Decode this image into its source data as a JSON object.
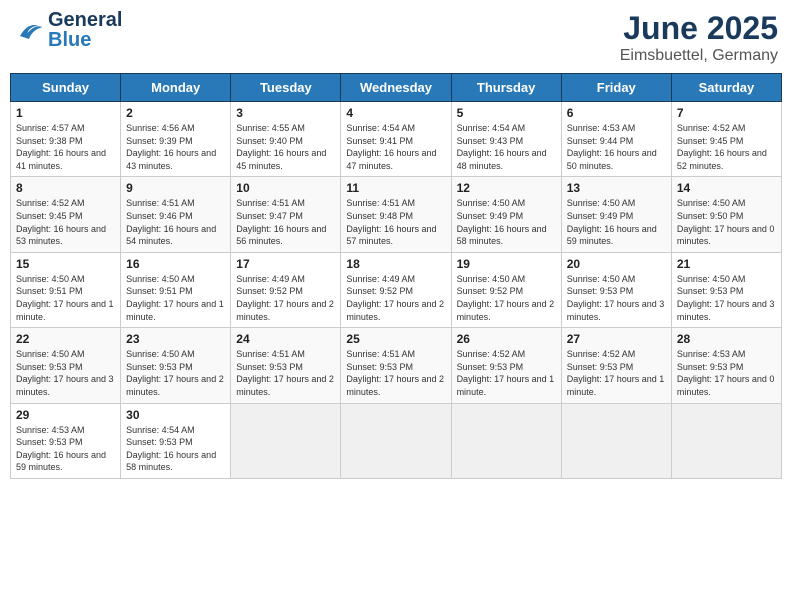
{
  "header": {
    "logo_general": "General",
    "logo_blue": "Blue",
    "title": "June 2025",
    "subtitle": "Eimsbuettel, Germany"
  },
  "calendar": {
    "weekdays": [
      "Sunday",
      "Monday",
      "Tuesday",
      "Wednesday",
      "Thursday",
      "Friday",
      "Saturday"
    ],
    "weeks": [
      [
        null,
        null,
        null,
        null,
        null,
        null,
        null
      ],
      null,
      null,
      null,
      null,
      null
    ],
    "days": [
      {
        "day": 1,
        "col": 0,
        "sunrise": "4:57 AM",
        "sunset": "9:38 PM",
        "daylight": "16 hours and 41 minutes."
      },
      {
        "day": 2,
        "col": 1,
        "sunrise": "4:56 AM",
        "sunset": "9:39 PM",
        "daylight": "16 hours and 43 minutes."
      },
      {
        "day": 3,
        "col": 2,
        "sunrise": "4:55 AM",
        "sunset": "9:40 PM",
        "daylight": "16 hours and 45 minutes."
      },
      {
        "day": 4,
        "col": 3,
        "sunrise": "4:54 AM",
        "sunset": "9:41 PM",
        "daylight": "16 hours and 47 minutes."
      },
      {
        "day": 5,
        "col": 4,
        "sunrise": "4:54 AM",
        "sunset": "9:43 PM",
        "daylight": "16 hours and 48 minutes."
      },
      {
        "day": 6,
        "col": 5,
        "sunrise": "4:53 AM",
        "sunset": "9:44 PM",
        "daylight": "16 hours and 50 minutes."
      },
      {
        "day": 7,
        "col": 6,
        "sunrise": "4:52 AM",
        "sunset": "9:45 PM",
        "daylight": "16 hours and 52 minutes."
      },
      {
        "day": 8,
        "col": 0,
        "sunrise": "4:52 AM",
        "sunset": "9:45 PM",
        "daylight": "16 hours and 53 minutes."
      },
      {
        "day": 9,
        "col": 1,
        "sunrise": "4:51 AM",
        "sunset": "9:46 PM",
        "daylight": "16 hours and 54 minutes."
      },
      {
        "day": 10,
        "col": 2,
        "sunrise": "4:51 AM",
        "sunset": "9:47 PM",
        "daylight": "16 hours and 56 minutes."
      },
      {
        "day": 11,
        "col": 3,
        "sunrise": "4:51 AM",
        "sunset": "9:48 PM",
        "daylight": "16 hours and 57 minutes."
      },
      {
        "day": 12,
        "col": 4,
        "sunrise": "4:50 AM",
        "sunset": "9:49 PM",
        "daylight": "16 hours and 58 minutes."
      },
      {
        "day": 13,
        "col": 5,
        "sunrise": "4:50 AM",
        "sunset": "9:49 PM",
        "daylight": "16 hours and 59 minutes."
      },
      {
        "day": 14,
        "col": 6,
        "sunrise": "4:50 AM",
        "sunset": "9:50 PM",
        "daylight": "17 hours and 0 minutes."
      },
      {
        "day": 15,
        "col": 0,
        "sunrise": "4:50 AM",
        "sunset": "9:51 PM",
        "daylight": "17 hours and 1 minute."
      },
      {
        "day": 16,
        "col": 1,
        "sunrise": "4:50 AM",
        "sunset": "9:51 PM",
        "daylight": "17 hours and 1 minute."
      },
      {
        "day": 17,
        "col": 2,
        "sunrise": "4:49 AM",
        "sunset": "9:52 PM",
        "daylight": "17 hours and 2 minutes."
      },
      {
        "day": 18,
        "col": 3,
        "sunrise": "4:49 AM",
        "sunset": "9:52 PM",
        "daylight": "17 hours and 2 minutes."
      },
      {
        "day": 19,
        "col": 4,
        "sunrise": "4:50 AM",
        "sunset": "9:52 PM",
        "daylight": "17 hours and 2 minutes."
      },
      {
        "day": 20,
        "col": 5,
        "sunrise": "4:50 AM",
        "sunset": "9:53 PM",
        "daylight": "17 hours and 3 minutes."
      },
      {
        "day": 21,
        "col": 6,
        "sunrise": "4:50 AM",
        "sunset": "9:53 PM",
        "daylight": "17 hours and 3 minutes."
      },
      {
        "day": 22,
        "col": 0,
        "sunrise": "4:50 AM",
        "sunset": "9:53 PM",
        "daylight": "17 hours and 3 minutes."
      },
      {
        "day": 23,
        "col": 1,
        "sunrise": "4:50 AM",
        "sunset": "9:53 PM",
        "daylight": "17 hours and 2 minutes."
      },
      {
        "day": 24,
        "col": 2,
        "sunrise": "4:51 AM",
        "sunset": "9:53 PM",
        "daylight": "17 hours and 2 minutes."
      },
      {
        "day": 25,
        "col": 3,
        "sunrise": "4:51 AM",
        "sunset": "9:53 PM",
        "daylight": "17 hours and 2 minutes."
      },
      {
        "day": 26,
        "col": 4,
        "sunrise": "4:52 AM",
        "sunset": "9:53 PM",
        "daylight": "17 hours and 1 minute."
      },
      {
        "day": 27,
        "col": 5,
        "sunrise": "4:52 AM",
        "sunset": "9:53 PM",
        "daylight": "17 hours and 1 minute."
      },
      {
        "day": 28,
        "col": 6,
        "sunrise": "4:53 AM",
        "sunset": "9:53 PM",
        "daylight": "17 hours and 0 minutes."
      },
      {
        "day": 29,
        "col": 0,
        "sunrise": "4:53 AM",
        "sunset": "9:53 PM",
        "daylight": "16 hours and 59 minutes."
      },
      {
        "day": 30,
        "col": 1,
        "sunrise": "4:54 AM",
        "sunset": "9:53 PM",
        "daylight": "16 hours and 58 minutes."
      }
    ]
  }
}
